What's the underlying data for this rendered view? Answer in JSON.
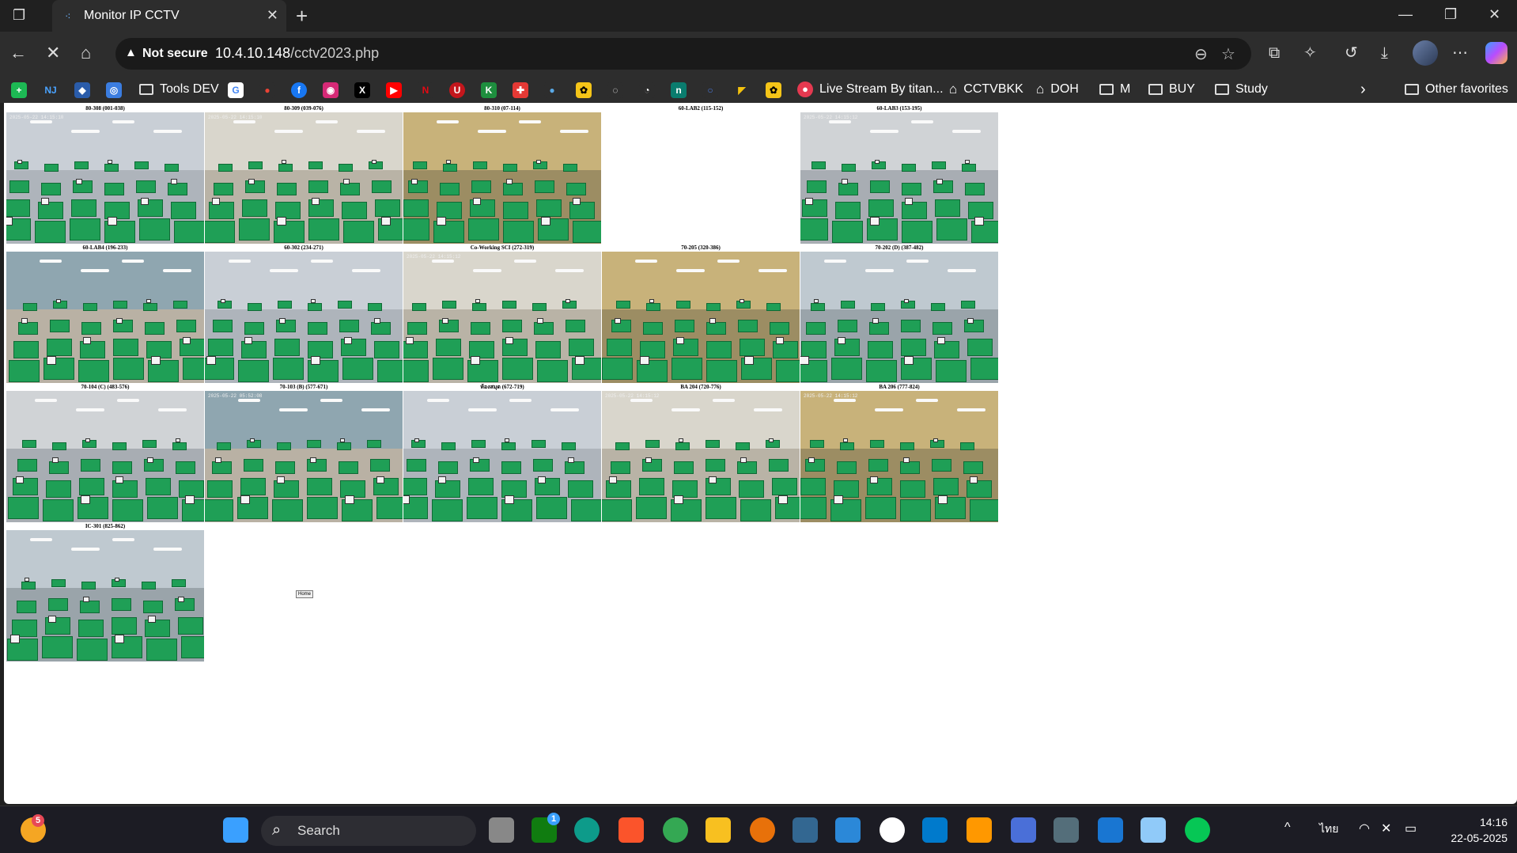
{
  "tab": {
    "title": "Monitor IP CCTV"
  },
  "address": {
    "security_label": "Not secure",
    "url_host": "10.4.10.148",
    "url_path": "/cctv2023.php"
  },
  "bookmarks": {
    "tools_dev": "Tools DEV",
    "live_stream": "Live Stream By titan...",
    "cctvbkk": "CCTVBKK",
    "doh": "DOH",
    "m": "M",
    "buy": "BUY",
    "study": "Study",
    "other_favorites": "Other favorites"
  },
  "cameras": [
    {
      "label": "80-308 (001-038)",
      "ts": "2025-05-22 14:15:10",
      "blank": false
    },
    {
      "label": "80-309 (039-076)",
      "ts": "2025-05-22 14:15:10",
      "blank": false
    },
    {
      "label": "80-310 (07-114)",
      "ts": "",
      "blank": false
    },
    {
      "label": "60-LAB2 (115-152)",
      "ts": "",
      "blank": true
    },
    {
      "label": "60-LAB3 (153-195)",
      "ts": "2025-05-22 14:15:12",
      "blank": false
    },
    {
      "label": "60-LAB4 (196-233)",
      "ts": "",
      "blank": false
    },
    {
      "label": "60-302 (234-271)",
      "ts": "",
      "blank": false
    },
    {
      "label": "Co-Working SCI (272-319)",
      "ts": "2025-05-22 14:15:12",
      "blank": false
    },
    {
      "label": "70-205 (320-386)",
      "ts": "",
      "blank": false
    },
    {
      "label": "70-202 (D) (387-482)",
      "ts": "",
      "blank": false
    },
    {
      "label": "70-104 (C) (483-576)",
      "ts": "",
      "blank": false
    },
    {
      "label": "70-103 (B) (577-671)",
      "ts": "2025-05-22 05:52:08",
      "blank": false
    },
    {
      "label": "ห้องสมุด (672-719)",
      "ts": "",
      "blank": false
    },
    {
      "label": "BA 204 (720-776)",
      "ts": "2025-05-22 14:15:12",
      "blank": false
    },
    {
      "label": "BA 206 (777-824)",
      "ts": "2025-05-22 14:15:12",
      "blank": false
    },
    {
      "label": "IC-301 (825-862)",
      "ts": "",
      "blank": false
    }
  ],
  "page": {
    "home_label": "Home"
  },
  "taskbar": {
    "search_label": "Search",
    "weather_badge": "5",
    "xbox_badge": "1",
    "language": "ไทย",
    "time": "14:16",
    "date": "22-05-2025"
  },
  "colors": {
    "chrome_bg": "#202020",
    "toolbar_bg": "#2d2d2d",
    "desk_green": "#1f9f56",
    "taskbar_bg": "#1c1c24"
  }
}
